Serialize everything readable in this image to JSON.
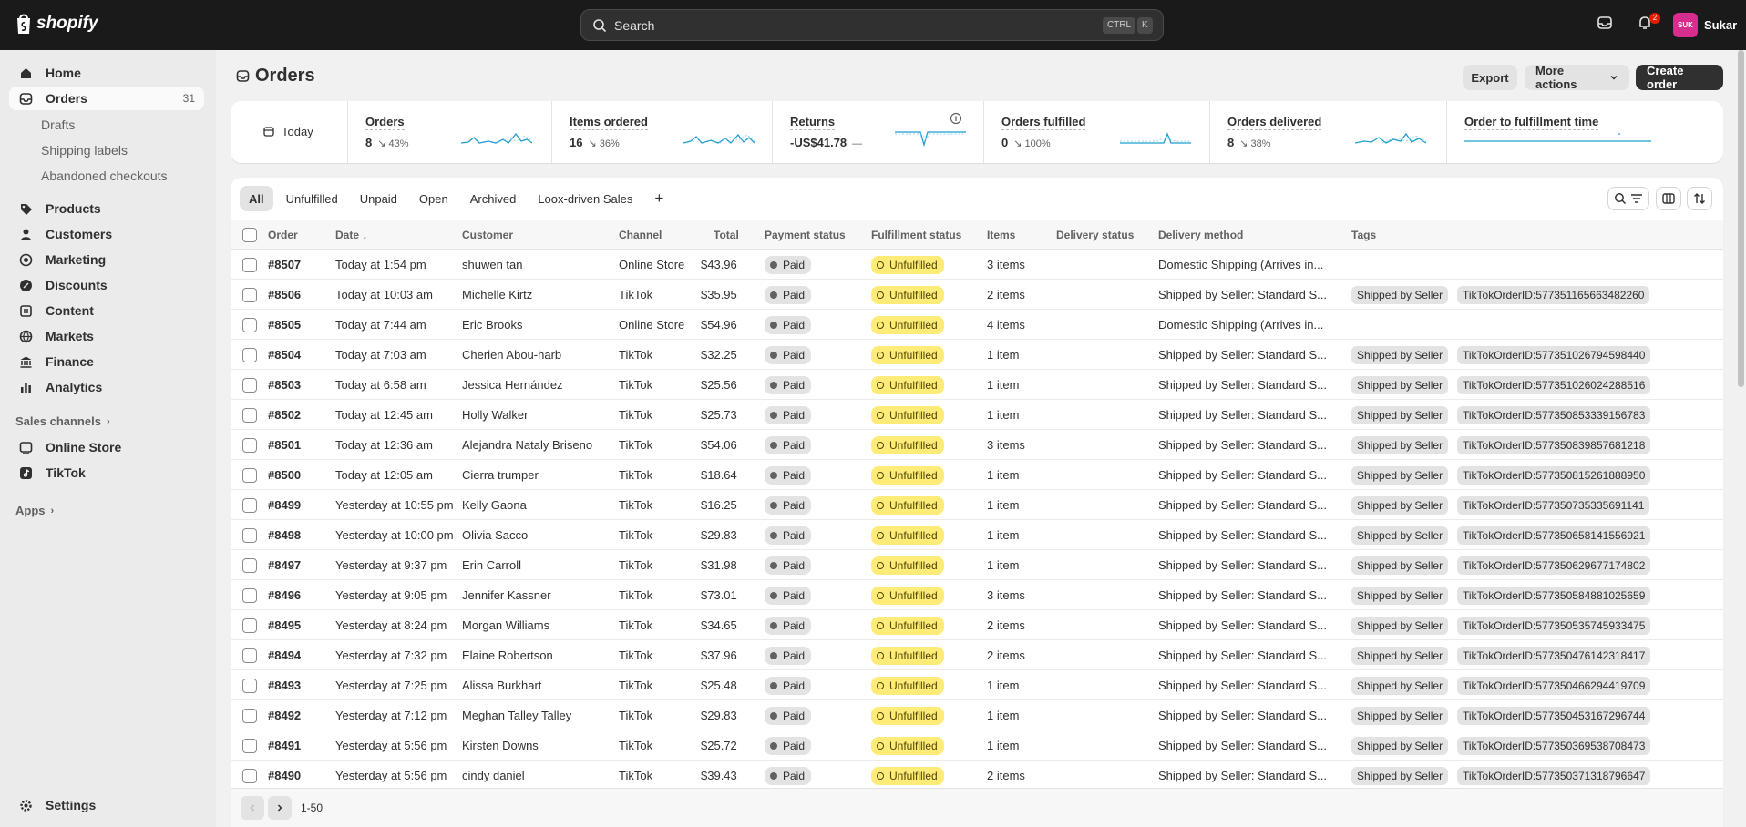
{
  "topbar": {
    "brand": "shopify",
    "search_placeholder": "Search",
    "shortcut_ctrl": "CTRL",
    "shortcut_k": "K",
    "notification_count": "2",
    "avatar_initials": "SUK",
    "user_name": "Sukar"
  },
  "sidebar": {
    "home": "Home",
    "orders": "Orders",
    "orders_count": "31",
    "drafts": "Drafts",
    "shipping_labels": "Shipping labels",
    "abandoned_checkouts": "Abandoned checkouts",
    "products": "Products",
    "customers": "Customers",
    "marketing": "Marketing",
    "discounts": "Discounts",
    "content": "Content",
    "markets": "Markets",
    "finance": "Finance",
    "analytics": "Analytics",
    "sales_channels": "Sales channels",
    "online_store": "Online Store",
    "tiktok": "TikTok",
    "apps": "Apps",
    "settings": "Settings"
  },
  "header": {
    "title": "Orders",
    "export": "Export",
    "more_actions": "More actions",
    "create_order": "Create order"
  },
  "metrics": {
    "date_range": "Today",
    "orders": {
      "label": "Orders",
      "value": "8",
      "delta": "↘ 43%"
    },
    "items_ordered": {
      "label": "Items ordered",
      "value": "16",
      "delta": "↘ 36%"
    },
    "returns": {
      "label": "Returns",
      "value": "-US$41.78",
      "delta": "—"
    },
    "orders_fulfilled": {
      "label": "Orders fulfilled",
      "value": "0",
      "delta": "↘ 100%"
    },
    "orders_delivered": {
      "label": "Orders delivered",
      "value": "8",
      "delta": "↘ 38%"
    },
    "fulfillment_time": {
      "label": "Order to fulfillment time"
    }
  },
  "tabs": [
    "All",
    "Unfulfilled",
    "Unpaid",
    "Open",
    "Archived",
    "Loox-driven Sales",
    "+"
  ],
  "columns": {
    "order": "Order",
    "date": "Date ↓",
    "customer": "Customer",
    "channel": "Channel",
    "total": "Total",
    "payment_status": "Payment status",
    "fulfillment_status": "Fulfillment status",
    "items": "Items",
    "delivery_status": "Delivery status",
    "delivery_method": "Delivery method",
    "tags": "Tags"
  },
  "orders": [
    {
      "order": "#8507",
      "date": "Today at 1:54 pm",
      "customer": "shuwen tan",
      "channel": "Online Store",
      "total": "$43.96",
      "payment": "Paid",
      "fulfillment": "Unfulfilled",
      "items": "3 items",
      "method": "Domestic Shipping (Arrives in...",
      "tag1": "",
      "tag2": ""
    },
    {
      "order": "#8506",
      "date": "Today at 10:03 am",
      "customer": "Michelle Kirtz",
      "channel": "TikTok",
      "total": "$35.95",
      "payment": "Paid",
      "fulfillment": "Unfulfilled",
      "items": "2 items",
      "method": "Shipped by Seller: Standard S...",
      "tag1": "Shipped by Seller",
      "tag2": "TikTokOrderID:577351165663482260"
    },
    {
      "order": "#8505",
      "date": "Today at 7:44 am",
      "customer": "Eric Brooks",
      "channel": "Online Store",
      "total": "$54.96",
      "payment": "Paid",
      "fulfillment": "Unfulfilled",
      "items": "4 items",
      "method": "Domestic Shipping (Arrives in...",
      "tag1": "",
      "tag2": ""
    },
    {
      "order": "#8504",
      "date": "Today at 7:03 am",
      "customer": "Cherien Abou-harb",
      "channel": "TikTok",
      "total": "$32.25",
      "payment": "Paid",
      "fulfillment": "Unfulfilled",
      "items": "1 item",
      "method": "Shipped by Seller: Standard S...",
      "tag1": "Shipped by Seller",
      "tag2": "TikTokOrderID:577351026794598440"
    },
    {
      "order": "#8503",
      "date": "Today at 6:58 am",
      "customer": "Jessica Hernández",
      "channel": "TikTok",
      "total": "$25.56",
      "payment": "Paid",
      "fulfillment": "Unfulfilled",
      "items": "1 item",
      "method": "Shipped by Seller: Standard S...",
      "tag1": "Shipped by Seller",
      "tag2": "TikTokOrderID:577351026024288516"
    },
    {
      "order": "#8502",
      "date": "Today at 12:45 am",
      "customer": "Holly Walker",
      "channel": "TikTok",
      "total": "$25.73",
      "payment": "Paid",
      "fulfillment": "Unfulfilled",
      "items": "1 item",
      "method": "Shipped by Seller: Standard S...",
      "tag1": "Shipped by Seller",
      "tag2": "TikTokOrderID:577350853339156783"
    },
    {
      "order": "#8501",
      "date": "Today at 12:36 am",
      "customer": "Alejandra Nataly Briseno",
      "channel": "TikTok",
      "total": "$54.06",
      "payment": "Paid",
      "fulfillment": "Unfulfilled",
      "items": "3 items",
      "method": "Shipped by Seller: Standard S...",
      "tag1": "Shipped by Seller",
      "tag2": "TikTokOrderID:577350839857681218"
    },
    {
      "order": "#8500",
      "date": "Today at 12:05 am",
      "customer": "Cierra trumper",
      "channel": "TikTok",
      "total": "$18.64",
      "payment": "Paid",
      "fulfillment": "Unfulfilled",
      "items": "1 item",
      "method": "Shipped by Seller: Standard S...",
      "tag1": "Shipped by Seller",
      "tag2": "TikTokOrderID:577350815261888950"
    },
    {
      "order": "#8499",
      "date": "Yesterday at 10:55 pm",
      "customer": "Kelly Gaona",
      "channel": "TikTok",
      "total": "$16.25",
      "payment": "Paid",
      "fulfillment": "Unfulfilled",
      "items": "1 item",
      "method": "Shipped by Seller: Standard S...",
      "tag1": "Shipped by Seller",
      "tag2": "TikTokOrderID:577350735335691141"
    },
    {
      "order": "#8498",
      "date": "Yesterday at 10:00 pm",
      "customer": "Olivia Sacco",
      "channel": "TikTok",
      "total": "$29.83",
      "payment": "Paid",
      "fulfillment": "Unfulfilled",
      "items": "1 item",
      "method": "Shipped by Seller: Standard S...",
      "tag1": "Shipped by Seller",
      "tag2": "TikTokOrderID:577350658141556921"
    },
    {
      "order": "#8497",
      "date": "Yesterday at 9:37 pm",
      "customer": "Erin Carroll",
      "channel": "TikTok",
      "total": "$31.98",
      "payment": "Paid",
      "fulfillment": "Unfulfilled",
      "items": "1 item",
      "method": "Shipped by Seller: Standard S...",
      "tag1": "Shipped by Seller",
      "tag2": "TikTokOrderID:577350629677174802"
    },
    {
      "order": "#8496",
      "date": "Yesterday at 9:05 pm",
      "customer": "Jennifer Kassner",
      "channel": "TikTok",
      "total": "$73.01",
      "payment": "Paid",
      "fulfillment": "Unfulfilled",
      "items": "3 items",
      "method": "Shipped by Seller: Standard S...",
      "tag1": "Shipped by Seller",
      "tag2": "TikTokOrderID:577350584881025659"
    },
    {
      "order": "#8495",
      "date": "Yesterday at 8:24 pm",
      "customer": "Morgan Williams",
      "channel": "TikTok",
      "total": "$34.65",
      "payment": "Paid",
      "fulfillment": "Unfulfilled",
      "items": "2 items",
      "method": "Shipped by Seller: Standard S...",
      "tag1": "Shipped by Seller",
      "tag2": "TikTokOrderID:577350535745933475"
    },
    {
      "order": "#8494",
      "date": "Yesterday at 7:32 pm",
      "customer": "Elaine Robertson",
      "channel": "TikTok",
      "total": "$37.96",
      "payment": "Paid",
      "fulfillment": "Unfulfilled",
      "items": "2 items",
      "method": "Shipped by Seller: Standard S...",
      "tag1": "Shipped by Seller",
      "tag2": "TikTokOrderID:577350476142318417"
    },
    {
      "order": "#8493",
      "date": "Yesterday at 7:25 pm",
      "customer": "Alissa Burkhart",
      "channel": "TikTok",
      "total": "$25.48",
      "payment": "Paid",
      "fulfillment": "Unfulfilled",
      "items": "1 item",
      "method": "Shipped by Seller: Standard S...",
      "tag1": "Shipped by Seller",
      "tag2": "TikTokOrderID:577350466294419709"
    },
    {
      "order": "#8492",
      "date": "Yesterday at 7:12 pm",
      "customer": "Meghan Talley Talley",
      "channel": "TikTok",
      "total": "$29.83",
      "payment": "Paid",
      "fulfillment": "Unfulfilled",
      "items": "1 item",
      "method": "Shipped by Seller: Standard S...",
      "tag1": "Shipped by Seller",
      "tag2": "TikTokOrderID:577350453167296744"
    },
    {
      "order": "#8491",
      "date": "Yesterday at 5:56 pm",
      "customer": "Kirsten Downs",
      "channel": "TikTok",
      "total": "$25.72",
      "payment": "Paid",
      "fulfillment": "Unfulfilled",
      "items": "1 item",
      "method": "Shipped by Seller: Standard S...",
      "tag1": "Shipped by Seller",
      "tag2": "TikTokOrderID:577350369538708473"
    },
    {
      "order": "#8490",
      "date": "Yesterday at 5:56 pm",
      "customer": "cindy daniel",
      "channel": "TikTok",
      "total": "$39.43",
      "payment": "Paid",
      "fulfillment": "Unfulfilled",
      "items": "2 items",
      "method": "Shipped by Seller: Standard S...",
      "tag1": "Shipped by Seller",
      "tag2": "TikTokOrderID:577350371318796647"
    }
  ],
  "pagination": {
    "range": "1-50"
  },
  "colors": {
    "topbar": "#1a1a1a",
    "unfulfilled_badge": "#ffeb78",
    "paid_badge": "#e3e3e3",
    "primary_button": "#303030",
    "avatar": "#d82c8e"
  }
}
